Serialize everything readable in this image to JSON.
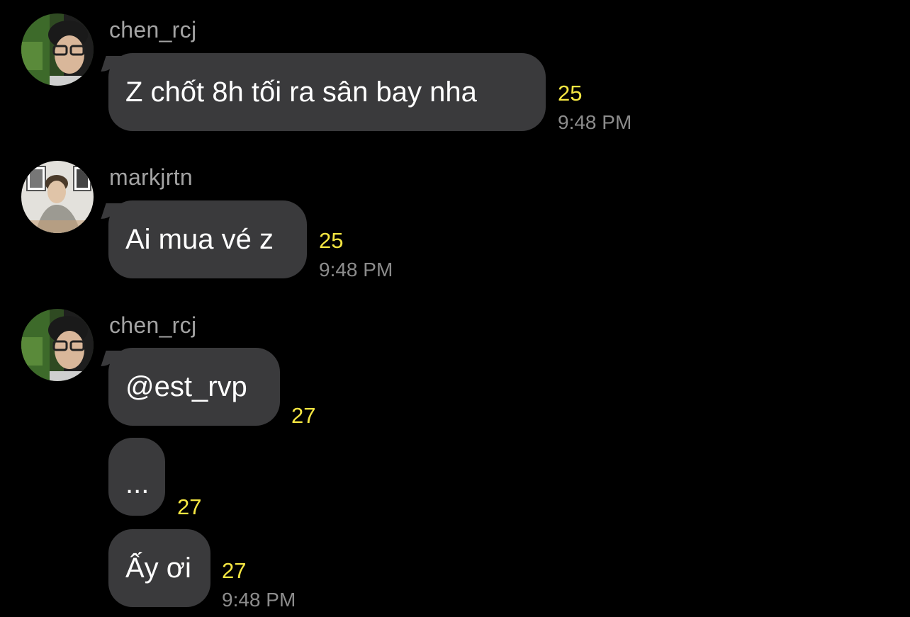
{
  "messages": [
    {
      "username": "chen_rcj",
      "bubbles": [
        {
          "text": "Z chốt 8h tối ra sân bay nha",
          "count": "25",
          "time": "9:48 PM"
        }
      ]
    },
    {
      "username": "markjrtn",
      "bubbles": [
        {
          "text": "Ai mua vé z",
          "count": "25",
          "time": "9:48 PM"
        }
      ]
    },
    {
      "username": "chen_rcj",
      "bubbles": [
        {
          "text": "@est_rvp",
          "count": "27"
        },
        {
          "text": "...",
          "count": "27"
        },
        {
          "text": "Ấy ơi",
          "count": "27",
          "time": "9:48 PM"
        }
      ]
    }
  ],
  "colors": {
    "background": "#000000",
    "bubble": "#3a3a3c",
    "bubble_text": "#ffffff",
    "username": "#a3a3a3",
    "count": "#f5e642",
    "timestamp": "#8c8c8c"
  },
  "icons": {
    "avatar_chen": "user-avatar-photo",
    "avatar_mark": "user-avatar-photo"
  }
}
